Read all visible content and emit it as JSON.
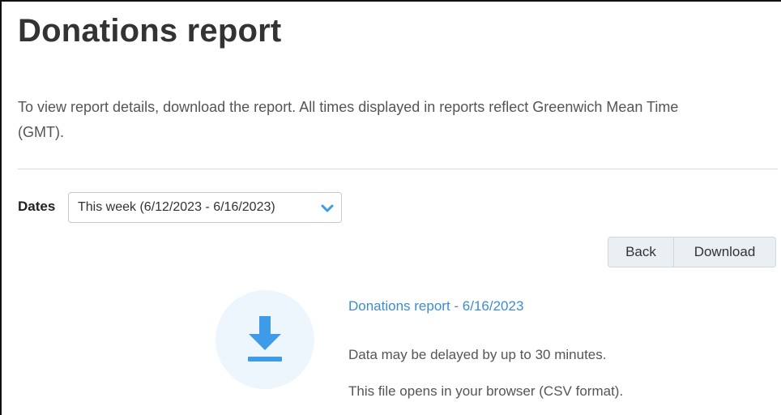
{
  "page": {
    "title": "Donations report",
    "intro": "To view report details, download the report. All times displayed in reports reflect Greenwich Mean Time (GMT)."
  },
  "filters": {
    "dates_label": "Dates",
    "dates_selected": "This week (6/12/2023 - 6/16/2023)",
    "dates_icon": "chevron-down-icon"
  },
  "actions": {
    "back_label": "Back",
    "download_label": "Download"
  },
  "report": {
    "icon": "download-icon",
    "link_text": "Donations report - 6/16/2023",
    "delay_note": "Data may be delayed by up to 30 minutes.",
    "format_note": "This file opens in your browser (CSV format)."
  },
  "colors": {
    "accent": "#3c8dd0",
    "icon_blue": "#3d9be9",
    "icon_bg": "#eef6fd",
    "button_bg": "#e9eff3"
  }
}
